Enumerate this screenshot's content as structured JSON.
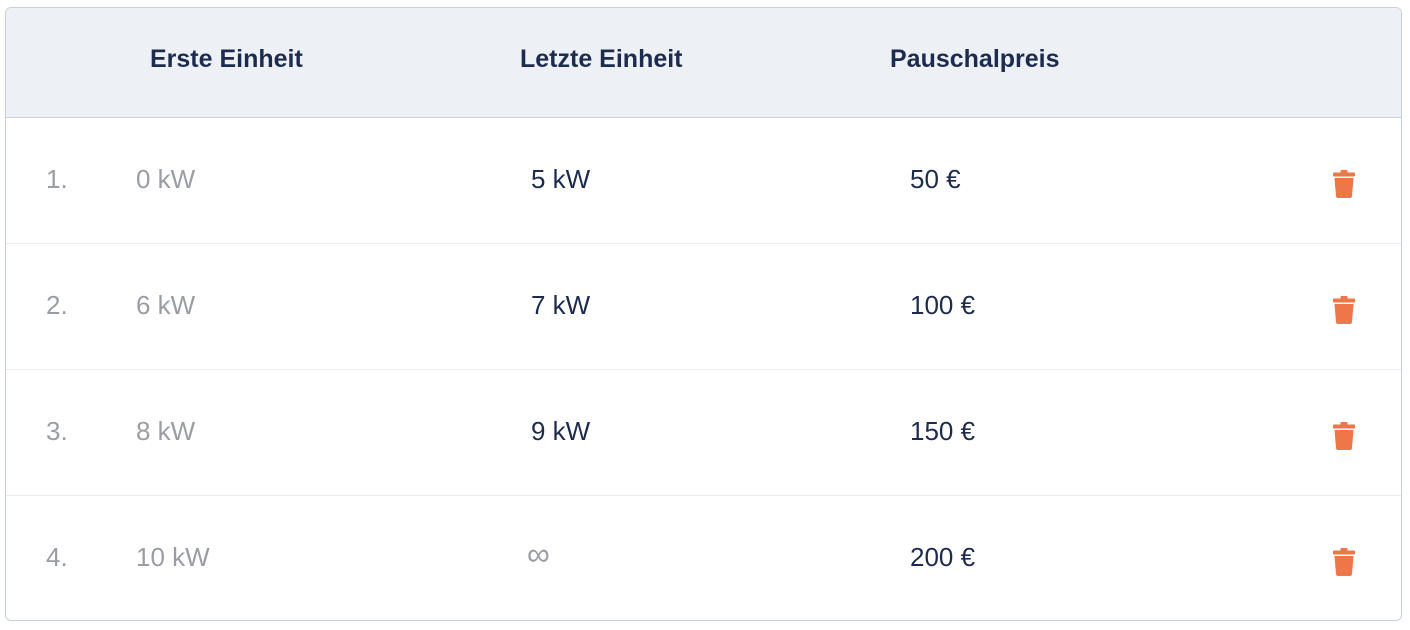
{
  "table": {
    "headers": {
      "first_unit": "Erste Einheit",
      "last_unit": "Letzte Einheit",
      "flat_price": "Pauschalpreis"
    },
    "rows": [
      {
        "index": "1.",
        "first_unit": "0 kW",
        "last_unit": "5 kW",
        "flat_price": "50 €"
      },
      {
        "index": "2.",
        "first_unit": "6 kW",
        "last_unit": "7 kW",
        "flat_price": "100 €"
      },
      {
        "index": "3.",
        "first_unit": "8 kW",
        "last_unit": "9 kW",
        "flat_price": "150 €"
      },
      {
        "index": "4.",
        "first_unit": "10 kW",
        "last_unit": "∞",
        "flat_price": "200 €"
      }
    ],
    "delete_icon": "trash-icon",
    "colors": {
      "header_bg": "#edf1f6",
      "header_text": "#1d2b4f",
      "muted_text": "#9a9ea4",
      "delete_accent": "#ee7648"
    }
  }
}
